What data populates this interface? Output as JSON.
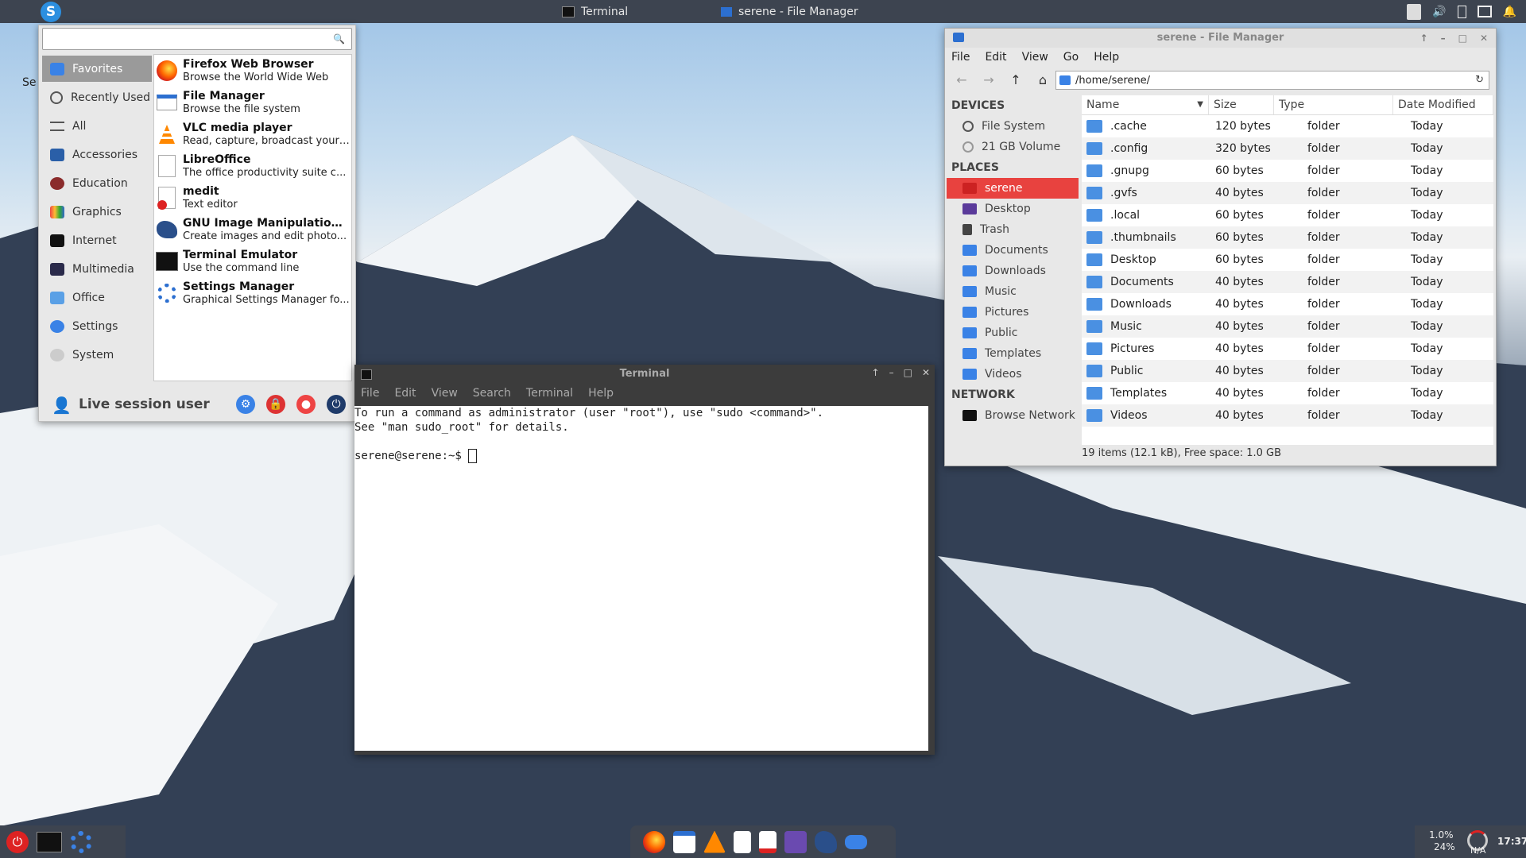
{
  "taskbar": {
    "tasks": [
      "Terminal",
      "serene - File Manager"
    ]
  },
  "whisker_menu": {
    "search_placeholder": "",
    "categories": [
      "Favorites",
      "Recently Used",
      "All",
      "Accessories",
      "Education",
      "Graphics",
      "Internet",
      "Multimedia",
      "Office",
      "Settings",
      "System"
    ],
    "apps": [
      {
        "name": "Firefox Web Browser",
        "desc": "Browse the World Wide Web"
      },
      {
        "name": "File Manager",
        "desc": "Browse the file system"
      },
      {
        "name": "VLC media player",
        "desc": "Read, capture, broadcast your ..."
      },
      {
        "name": "LibreOffice",
        "desc": "The office productivity suite c..."
      },
      {
        "name": "medit",
        "desc": "Text editor"
      },
      {
        "name": "GNU Image Manipulation ...",
        "desc": "Create images and edit photo..."
      },
      {
        "name": "Terminal Emulator",
        "desc": "Use the command line"
      },
      {
        "name": "Settings Manager",
        "desc": "Graphical Settings Manager fo..."
      }
    ],
    "user": "Live session user"
  },
  "terminal": {
    "title": "Terminal",
    "menu": [
      "File",
      "Edit",
      "View",
      "Search",
      "Terminal",
      "Help"
    ],
    "lines": [
      "To run a command as administrator (user \"root\"), use \"sudo <command>\".",
      "See \"man sudo_root\" for details.",
      "",
      "serene@serene:~$ "
    ]
  },
  "file_manager": {
    "title": "serene - File Manager",
    "menu": [
      "File",
      "Edit",
      "View",
      "Go",
      "Help"
    ],
    "path": "/home/serene/",
    "sidebar": {
      "devices_header": "DEVICES",
      "devices": [
        "File System",
        "21 GB Volume"
      ],
      "places_header": "PLACES",
      "places": [
        "serene",
        "Desktop",
        "Trash",
        "Documents",
        "Downloads",
        "Music",
        "Pictures",
        "Public",
        "Templates",
        "Videos"
      ],
      "network_header": "NETWORK",
      "network": [
        "Browse Network"
      ]
    },
    "columns": [
      "Name",
      "Size",
      "Type",
      "Date Modified"
    ],
    "rows": [
      {
        "name": ".cache",
        "size": "120 bytes",
        "type": "folder",
        "date": "Today"
      },
      {
        "name": ".config",
        "size": "320 bytes",
        "type": "folder",
        "date": "Today"
      },
      {
        "name": ".gnupg",
        "size": "60 bytes",
        "type": "folder",
        "date": "Today"
      },
      {
        "name": ".gvfs",
        "size": "40 bytes",
        "type": "folder",
        "date": "Today"
      },
      {
        "name": ".local",
        "size": "60 bytes",
        "type": "folder",
        "date": "Today"
      },
      {
        "name": ".thumbnails",
        "size": "60 bytes",
        "type": "folder",
        "date": "Today"
      },
      {
        "name": "Desktop",
        "size": "60 bytes",
        "type": "folder",
        "date": "Today"
      },
      {
        "name": "Documents",
        "size": "40 bytes",
        "type": "folder",
        "date": "Today"
      },
      {
        "name": "Downloads",
        "size": "40 bytes",
        "type": "folder",
        "date": "Today"
      },
      {
        "name": "Music",
        "size": "40 bytes",
        "type": "folder",
        "date": "Today"
      },
      {
        "name": "Pictures",
        "size": "40 bytes",
        "type": "folder",
        "date": "Today"
      },
      {
        "name": "Public",
        "size": "40 bytes",
        "type": "folder",
        "date": "Today"
      },
      {
        "name": "Templates",
        "size": "40 bytes",
        "type": "folder",
        "date": "Today"
      },
      {
        "name": "Videos",
        "size": "40 bytes",
        "type": "folder",
        "date": "Today"
      }
    ],
    "status": "19 items (12.1 kB), Free space: 1.0 GB"
  },
  "panel_right": {
    "cpu": "1.0%",
    "mem": "24%",
    "na": "N/A",
    "clock": "17:37"
  },
  "desktop_icon_label": "Se"
}
